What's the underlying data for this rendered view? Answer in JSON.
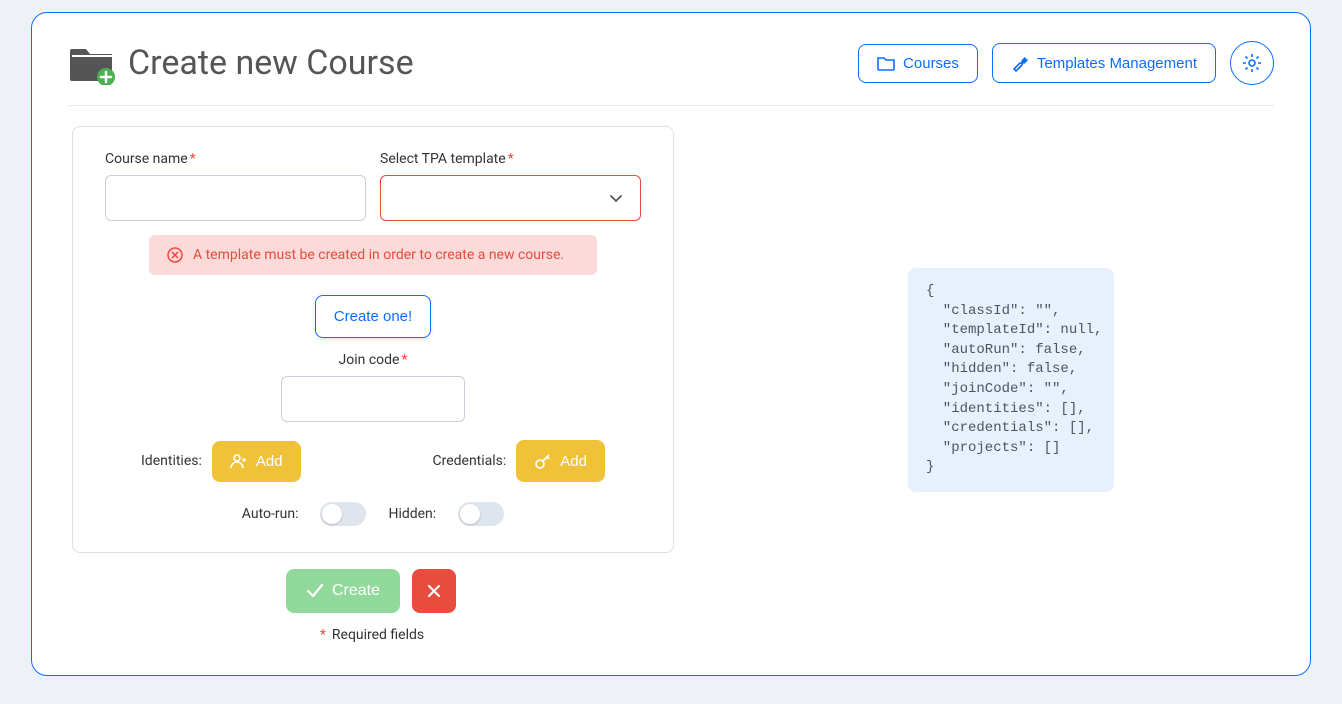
{
  "header": {
    "title": "Create new Course",
    "courses_btn": "Courses",
    "templates_btn": "Templates Management"
  },
  "form": {
    "course_name_label": "Course name",
    "template_label": "Select TPA template",
    "alert_text": "A template must be created in order to create a new course.",
    "create_template_btn": "Create one!",
    "join_code_label": "Join code",
    "identities_label": "Identities:",
    "credentials_label": "Credentials:",
    "add_btn": "Add",
    "autorun_label": "Auto-run:",
    "hidden_label": "Hidden:"
  },
  "footer": {
    "create_btn": "Create",
    "required_note": "Required fields"
  },
  "json_preview": "{\n  \"classId\": \"\",\n  \"templateId\": null,\n  \"autoRun\": false,\n  \"hidden\": false,\n  \"joinCode\": \"\",\n  \"identities\": [],\n  \"credentials\": [],\n  \"projects\": []\n}"
}
